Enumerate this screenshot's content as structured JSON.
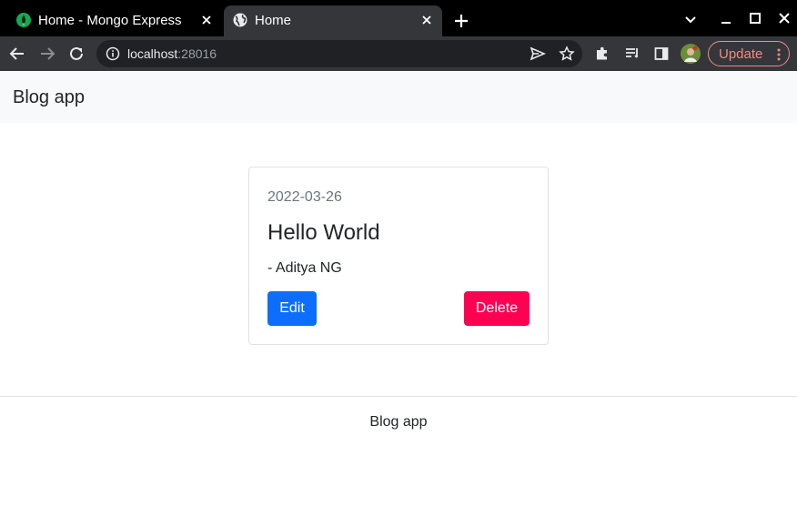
{
  "browser": {
    "tabs": [
      {
        "title": "Home - Mongo Express",
        "favicon": "mongodb-leaf-icon",
        "active": false
      },
      {
        "title": "Home",
        "favicon": "globe-icon",
        "active": true
      }
    ],
    "address": {
      "host": "localhost",
      "port": ":28016"
    },
    "update_label": "Update",
    "colors": {
      "tabstrip": "#000000",
      "toolbar": "#35363a",
      "omnibox": "#202124",
      "update": "#f28b82"
    }
  },
  "navbar": {
    "brand": "Blog app"
  },
  "posts": [
    {
      "date": "2022-03-26",
      "title": "Hello World",
      "author": "- Aditya NG",
      "edit_label": "Edit",
      "delete_label": "Delete"
    }
  ],
  "footer": {
    "text": "Blog app"
  },
  "colors": {
    "edit_button": "#0d6efd",
    "delete_button": "#ff0052",
    "navbar_bg": "#f8f9fa"
  }
}
